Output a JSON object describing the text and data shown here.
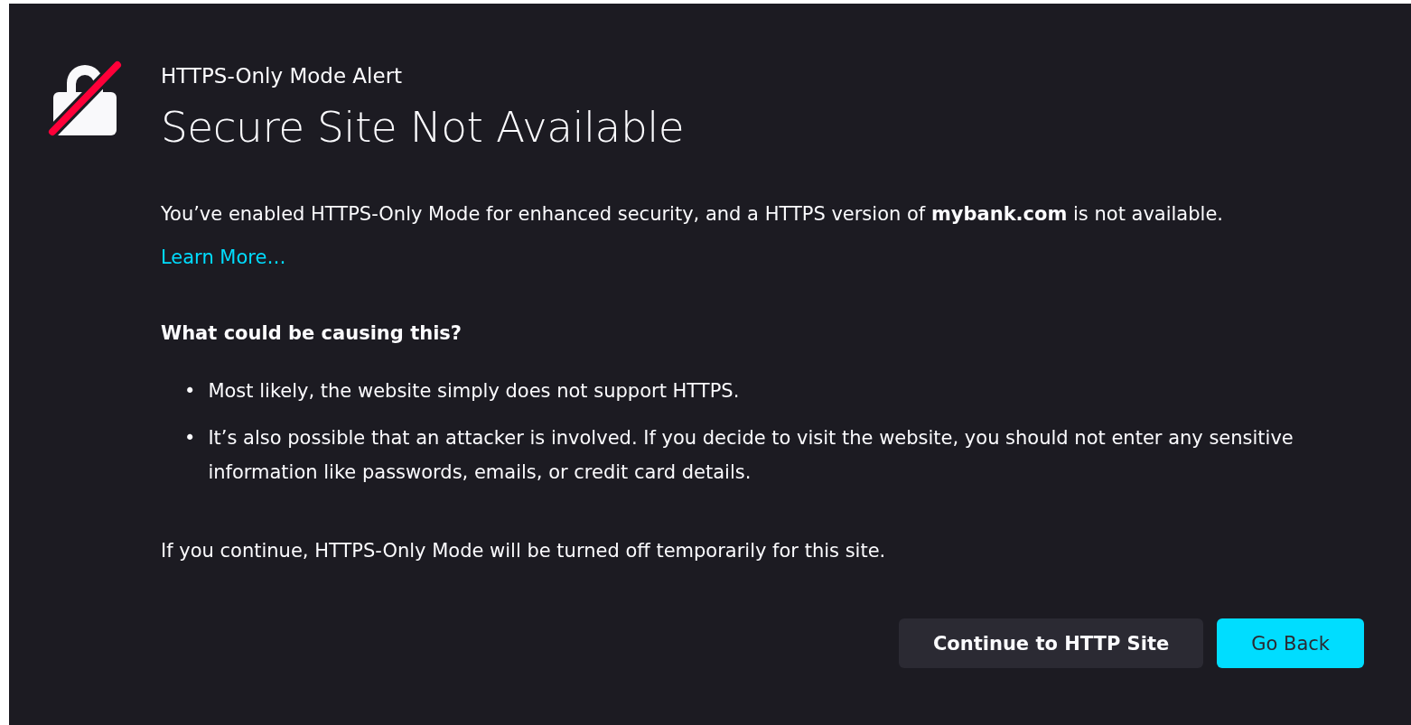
{
  "alert": {
    "label": "HTTPS-Only Mode Alert",
    "title": "Secure Site Not Available",
    "description": "You’ve enabled HTTPS-Only Mode for enhanced security, and a HTTPS version of **mybank.com** is not available.",
    "learn_more": "Learn More…",
    "causes_heading": "What could be causing this?",
    "causes": [
      {
        "bullet": "•",
        "text": "Most likely, the website simply does not support HTTPS."
      },
      {
        "bullet": "•",
        "text": "It’s also possible that an attacker is involved. If you decide to visit the website, you should not enter any sensitive information like passwords, emails, or credit card details."
      }
    ],
    "note": "If you continue, HTTPS-Only Mode will be turned off temporarily for this site.",
    "buttons": [
      {
        "label": "Continue to HTTP Site",
        "kind": "secondary"
      },
      {
        "label": "Go Back",
        "kind": "primary"
      }
    ]
  }
}
